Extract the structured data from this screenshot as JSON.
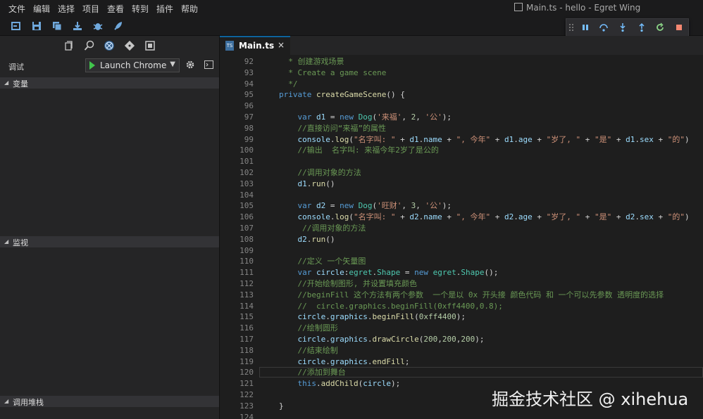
{
  "menu": [
    "文件",
    "编辑",
    "选择",
    "项目",
    "查看",
    "转到",
    "插件",
    "帮助"
  ],
  "window_title": "Main.ts - hello - Egret Wing",
  "toolbar_icons": [
    "new-project-icon",
    "save-icon",
    "save-all-icon",
    "publish-icon",
    "debug-bug-icon",
    "rocket-icon"
  ],
  "debug_toolbar_icons": [
    "grip-icon",
    "pause-icon",
    "step-over-icon",
    "step-into-icon",
    "step-out-icon",
    "restart-icon",
    "stop-icon"
  ],
  "sidebar": {
    "view_icons": [
      "files-icon",
      "search-icon",
      "debug-icon",
      "git-icon",
      "extensions-icon"
    ],
    "debug_label": "调试",
    "launch_config": "Launch Chrome",
    "sections": [
      "变量",
      "监视",
      "调用堆栈"
    ]
  },
  "tab": {
    "icon_text": "TS",
    "label": "Main.ts",
    "close": "×"
  },
  "editor": {
    "lines": [
      {
        "n": "92",
        "tokens": [
          [
            "c",
            "  * 创建游戏场景"
          ]
        ]
      },
      {
        "n": "93",
        "tokens": [
          [
            "c",
            "  * Create a game scene"
          ]
        ]
      },
      {
        "n": "94",
        "tokens": [
          [
            "c",
            "  */"
          ]
        ]
      },
      {
        "n": "95",
        "tokens": [
          [
            "k",
            "private "
          ],
          [
            "f",
            "createGameScene"
          ],
          [
            "p",
            "() {"
          ]
        ]
      },
      {
        "n": "96",
        "tokens": []
      },
      {
        "n": "97",
        "tokens": [
          [
            "p",
            "    "
          ],
          [
            "k",
            "var "
          ],
          [
            "v",
            "d1"
          ],
          [
            "p",
            " = "
          ],
          [
            "k",
            "new "
          ],
          [
            "t",
            "Dog"
          ],
          [
            "p",
            "("
          ],
          [
            "s",
            "'来福'"
          ],
          [
            "p",
            ", "
          ],
          [
            "n",
            "2"
          ],
          [
            "p",
            ", "
          ],
          [
            "s",
            "'公'"
          ],
          [
            "p",
            ");"
          ]
        ]
      },
      {
        "n": "98",
        "tokens": [
          [
            "c",
            "    //直接访问“来福”的属性"
          ]
        ]
      },
      {
        "n": "99",
        "tokens": [
          [
            "p",
            "    "
          ],
          [
            "v",
            "console"
          ],
          [
            "p",
            "."
          ],
          [
            "f",
            "log"
          ],
          [
            "p",
            "("
          ],
          [
            "s",
            "\"名字叫: \""
          ],
          [
            "p",
            " + "
          ],
          [
            "v",
            "d1"
          ],
          [
            "p",
            "."
          ],
          [
            "v",
            "name"
          ],
          [
            "p",
            " + "
          ],
          [
            "s",
            "\", 今年\""
          ],
          [
            "p",
            " + "
          ],
          [
            "v",
            "d1"
          ],
          [
            "p",
            "."
          ],
          [
            "v",
            "age"
          ],
          [
            "p",
            " + "
          ],
          [
            "s",
            "\"岁了, \""
          ],
          [
            "p",
            " + "
          ],
          [
            "s",
            "\"是\""
          ],
          [
            "p",
            " + "
          ],
          [
            "v",
            "d1"
          ],
          [
            "p",
            "."
          ],
          [
            "v",
            "sex"
          ],
          [
            "p",
            " + "
          ],
          [
            "s",
            "\"的\""
          ],
          [
            "p",
            ")"
          ]
        ]
      },
      {
        "n": "100",
        "tokens": [
          [
            "c",
            "    //输出  名字叫: 来福今年2岁了是公的"
          ]
        ]
      },
      {
        "n": "101",
        "tokens": []
      },
      {
        "n": "102",
        "tokens": [
          [
            "c",
            "    //调用对象的方法"
          ]
        ]
      },
      {
        "n": "103",
        "tokens": [
          [
            "p",
            "    "
          ],
          [
            "v",
            "d1"
          ],
          [
            "p",
            "."
          ],
          [
            "f",
            "run"
          ],
          [
            "p",
            "()"
          ]
        ]
      },
      {
        "n": "104",
        "tokens": []
      },
      {
        "n": "105",
        "tokens": [
          [
            "p",
            "    "
          ],
          [
            "k",
            "var "
          ],
          [
            "v",
            "d2"
          ],
          [
            "p",
            " = "
          ],
          [
            "k",
            "new "
          ],
          [
            "t",
            "Dog"
          ],
          [
            "p",
            "("
          ],
          [
            "s",
            "'旺财'"
          ],
          [
            "p",
            ", "
          ],
          [
            "n",
            "3"
          ],
          [
            "p",
            ", "
          ],
          [
            "s",
            "'公'"
          ],
          [
            "p",
            ");"
          ]
        ]
      },
      {
        "n": "106",
        "tokens": [
          [
            "p",
            "    "
          ],
          [
            "v",
            "console"
          ],
          [
            "p",
            "."
          ],
          [
            "f",
            "log"
          ],
          [
            "p",
            "("
          ],
          [
            "s",
            "\"名字叫: \""
          ],
          [
            "p",
            " + "
          ],
          [
            "v",
            "d2"
          ],
          [
            "p",
            "."
          ],
          [
            "v",
            "name"
          ],
          [
            "p",
            " + "
          ],
          [
            "s",
            "\", 今年\""
          ],
          [
            "p",
            " + "
          ],
          [
            "v",
            "d2"
          ],
          [
            "p",
            "."
          ],
          [
            "v",
            "age"
          ],
          [
            "p",
            " + "
          ],
          [
            "s",
            "\"岁了, \""
          ],
          [
            "p",
            " + "
          ],
          [
            "s",
            "\"是\""
          ],
          [
            "p",
            " + "
          ],
          [
            "v",
            "d2"
          ],
          [
            "p",
            "."
          ],
          [
            "v",
            "sex"
          ],
          [
            "p",
            " + "
          ],
          [
            "s",
            "\"的\""
          ],
          [
            "p",
            ")"
          ]
        ]
      },
      {
        "n": "107",
        "tokens": [
          [
            "c",
            "     //调用对象的方法"
          ]
        ]
      },
      {
        "n": "108",
        "tokens": [
          [
            "p",
            "    "
          ],
          [
            "v",
            "d2"
          ],
          [
            "p",
            "."
          ],
          [
            "f",
            "run"
          ],
          [
            "p",
            "()"
          ]
        ]
      },
      {
        "n": "109",
        "tokens": []
      },
      {
        "n": "110",
        "tokens": [
          [
            "c",
            "    //定义 一个矢量图"
          ]
        ]
      },
      {
        "n": "111",
        "tokens": [
          [
            "p",
            "    "
          ],
          [
            "k",
            "var "
          ],
          [
            "v",
            "circle"
          ],
          [
            "p",
            ":"
          ],
          [
            "t",
            "egret"
          ],
          [
            "p",
            "."
          ],
          [
            "t",
            "Shape"
          ],
          [
            "p",
            " = "
          ],
          [
            "k",
            "new "
          ],
          [
            "t",
            "egret"
          ],
          [
            "p",
            "."
          ],
          [
            "t",
            "Shape"
          ],
          [
            "p",
            "();"
          ]
        ]
      },
      {
        "n": "112",
        "tokens": [
          [
            "c",
            "    //开始绘制图形, 并设置填充颜色"
          ]
        ]
      },
      {
        "n": "113",
        "tokens": [
          [
            "c",
            "    //beginFill 这个方法有两个参数  一个是以 0x 开头接 颜色代码 和 一个可以先参数 透明度的选择"
          ]
        ]
      },
      {
        "n": "114",
        "tokens": [
          [
            "c",
            "    //  circle.graphics.beginFill(0xff4400,0.8);"
          ]
        ]
      },
      {
        "n": "115",
        "tokens": [
          [
            "p",
            "    "
          ],
          [
            "v",
            "circle"
          ],
          [
            "p",
            "."
          ],
          [
            "v",
            "graphics"
          ],
          [
            "p",
            "."
          ],
          [
            "f",
            "beginFill"
          ],
          [
            "p",
            "("
          ],
          [
            "n",
            "0xff4400"
          ],
          [
            "p",
            ");"
          ]
        ]
      },
      {
        "n": "116",
        "tokens": [
          [
            "c",
            "    //绘制圆形"
          ]
        ]
      },
      {
        "n": "117",
        "tokens": [
          [
            "p",
            "    "
          ],
          [
            "v",
            "circle"
          ],
          [
            "p",
            "."
          ],
          [
            "v",
            "graphics"
          ],
          [
            "p",
            "."
          ],
          [
            "f",
            "drawCircle"
          ],
          [
            "p",
            "("
          ],
          [
            "n",
            "200"
          ],
          [
            "p",
            ","
          ],
          [
            "n",
            "200"
          ],
          [
            "p",
            ","
          ],
          [
            "n",
            "200"
          ],
          [
            "p",
            ");"
          ]
        ]
      },
      {
        "n": "118",
        "tokens": [
          [
            "c",
            "    //结束绘制"
          ]
        ]
      },
      {
        "n": "119",
        "tokens": [
          [
            "p",
            "    "
          ],
          [
            "v",
            "circle"
          ],
          [
            "p",
            "."
          ],
          [
            "v",
            "graphics"
          ],
          [
            "p",
            "."
          ],
          [
            "f",
            "endFill"
          ],
          [
            "p",
            ";"
          ]
        ]
      },
      {
        "n": "120",
        "tokens": [
          [
            "c",
            "    //添加到舞台"
          ]
        ]
      },
      {
        "n": "121",
        "tokens": [
          [
            "p",
            "    "
          ],
          [
            "k",
            "this"
          ],
          [
            "p",
            "."
          ],
          [
            "f",
            "addChild"
          ],
          [
            "p",
            "("
          ],
          [
            "v",
            "circle"
          ],
          [
            "p",
            ");"
          ]
        ]
      },
      {
        "n": "122",
        "tokens": []
      },
      {
        "n": "123",
        "tokens": [
          [
            "p",
            "}"
          ]
        ]
      },
      {
        "n": "124",
        "tokens": []
      }
    ],
    "current_line": "120"
  },
  "watermark": "掘金技术社区 @ xihehua"
}
